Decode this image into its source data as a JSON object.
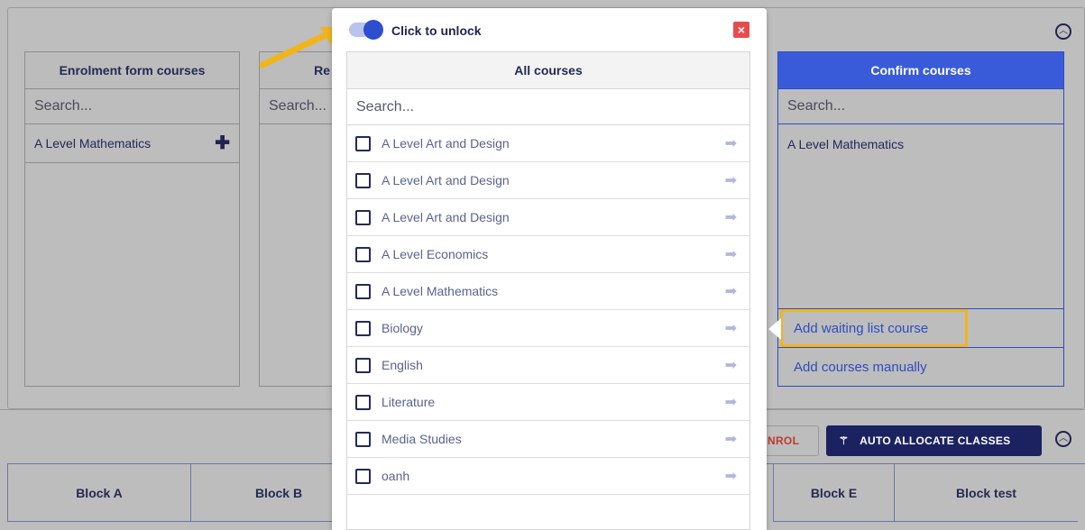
{
  "panel": {
    "columns": [
      {
        "title": "Enrolment form courses",
        "search_placeholder": "Search...",
        "items": [
          "A Level Mathematics"
        ]
      },
      {
        "title": "Re",
        "search_placeholder": "Search...",
        "items": []
      },
      {
        "title": "Confirm courses",
        "search_placeholder": "Search...",
        "items": [
          "A Level Mathematics"
        ]
      }
    ],
    "waiting_list_link": "Add waiting list course",
    "manual_link": "Add courses manually"
  },
  "toolbar": {
    "enrol_label": "NROL",
    "auto_allocate_label": "AUTO ALLOCATE CLASSES"
  },
  "blocks": [
    "Block A",
    "Block B",
    "Block E",
    "Block test"
  ],
  "modal": {
    "toggle_label": "Click to unlock",
    "toggle_on": true,
    "list_title": "All courses",
    "search_placeholder": "Search...",
    "courses": [
      "A Level Art and Design",
      "A Level Art and Design",
      "A Level Art and Design",
      "A Level Economics",
      "A Level Mathematics",
      "Biology",
      "English",
      "Literature",
      "Media Studies",
      "oanh"
    ]
  },
  "colors": {
    "accent": "#3a5bd9",
    "navy": "#1c2260",
    "highlight": "#f2b41b",
    "close": "#e74c4c",
    "danger_text": "#c0392b"
  },
  "icons": [
    "plus-icon",
    "collapse-icon",
    "close-icon",
    "arrow-right-icon",
    "magic-wand-icon",
    "toggle-icon"
  ]
}
